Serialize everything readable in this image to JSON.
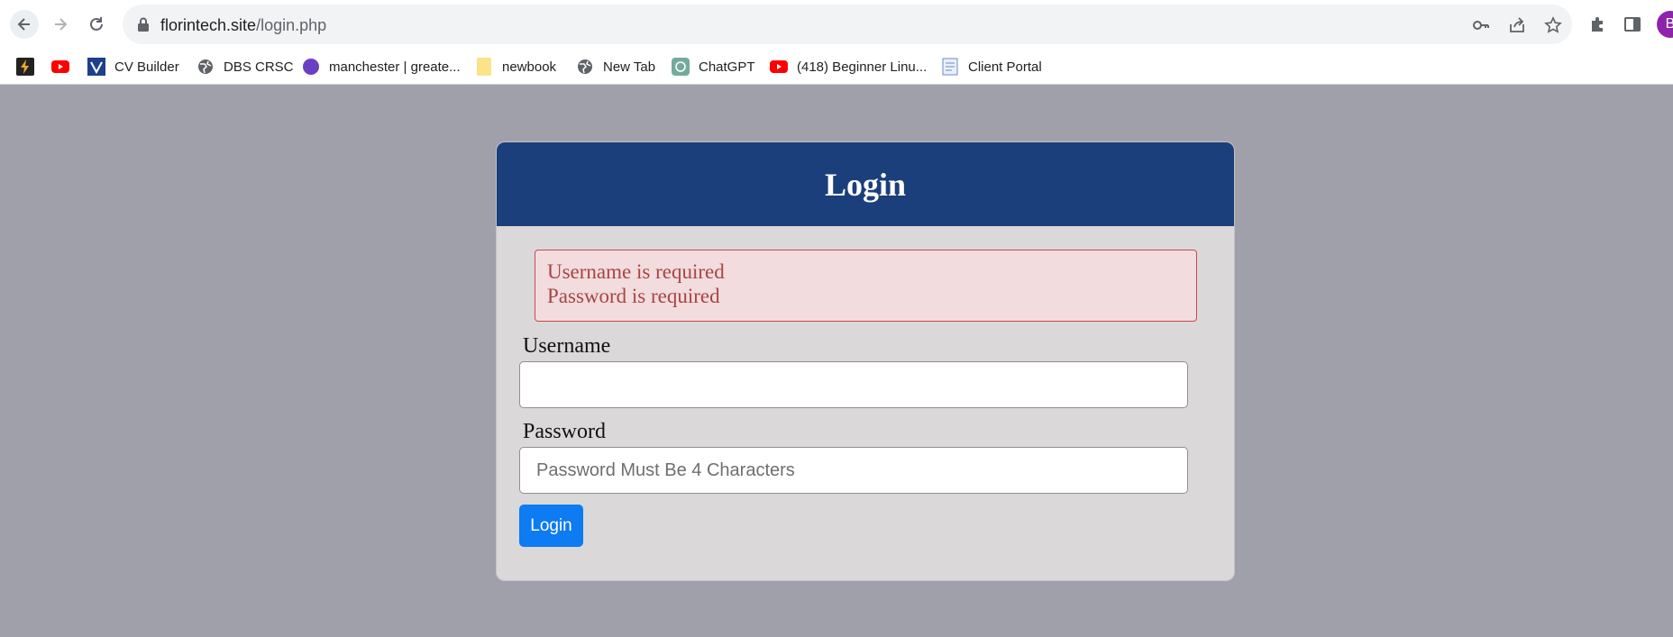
{
  "browser": {
    "url_domain": "florintech.site",
    "url_path": "/login.php",
    "profile_initial": "B"
  },
  "bookmarks": [
    {
      "label": "",
      "icon": "lightning-bookmark-icon"
    },
    {
      "label": "",
      "icon": "youtube-icon"
    },
    {
      "label": "CV Builder",
      "icon": "cv-builder-icon"
    },
    {
      "label": "DBS CRSC",
      "icon": "globe-icon"
    },
    {
      "label": "manchester | greate...",
      "icon": "purple-circle-icon"
    },
    {
      "label": "newbook",
      "icon": "folder-icon"
    },
    {
      "label": "New Tab",
      "icon": "globe-icon"
    },
    {
      "label": "ChatGPT",
      "icon": "chatgpt-icon"
    },
    {
      "label": "(418) Beginner Linu...",
      "icon": "youtube-icon"
    },
    {
      "label": "Client Portal",
      "icon": "document-icon"
    }
  ],
  "login": {
    "title": "Login",
    "errors": [
      "Username is required",
      "Password is required"
    ],
    "username_label": "Username",
    "username_value": "",
    "password_label": "Password",
    "password_placeholder": "Password Must Be 4 Characters",
    "submit_label": "Login"
  },
  "colors": {
    "page_bg": "#a0a0ab",
    "header_bg": "#1b3f7a",
    "card_bg": "#dbd8d9",
    "alert_bg": "#f2dcdd",
    "alert_text": "#a94442",
    "button_bg": "#0d7bf2"
  }
}
